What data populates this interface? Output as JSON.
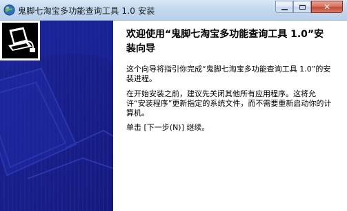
{
  "window": {
    "title": "鬼脚七淘宝多功能查询工具 1.0 安装",
    "accent_color": "#1a1f8e"
  },
  "titlebar": {
    "icon": "installer-globe-icon",
    "minimize_icon": "minimize-icon",
    "maximize_icon": "maximize-icon",
    "close_icon": "close-icon",
    "close_glyph": "✕"
  },
  "banner": {
    "icon": "installer-computer-icon"
  },
  "content": {
    "heading": "欢迎使用“鬼脚七淘宝多功能查询工具 1.0”安装向导",
    "paragraph1": "这个向导将指引你完成“鬼脚七淘宝多功能查询工具 1.0”的安装进程。",
    "paragraph2": "在开始安装之前，建议先关闭其他所有应用程序。这将允许“安装程序”更新指定的系统文件，而不需要重新启动你的计算机。",
    "paragraph3": "单击 [下一步(N)] 继续。"
  }
}
